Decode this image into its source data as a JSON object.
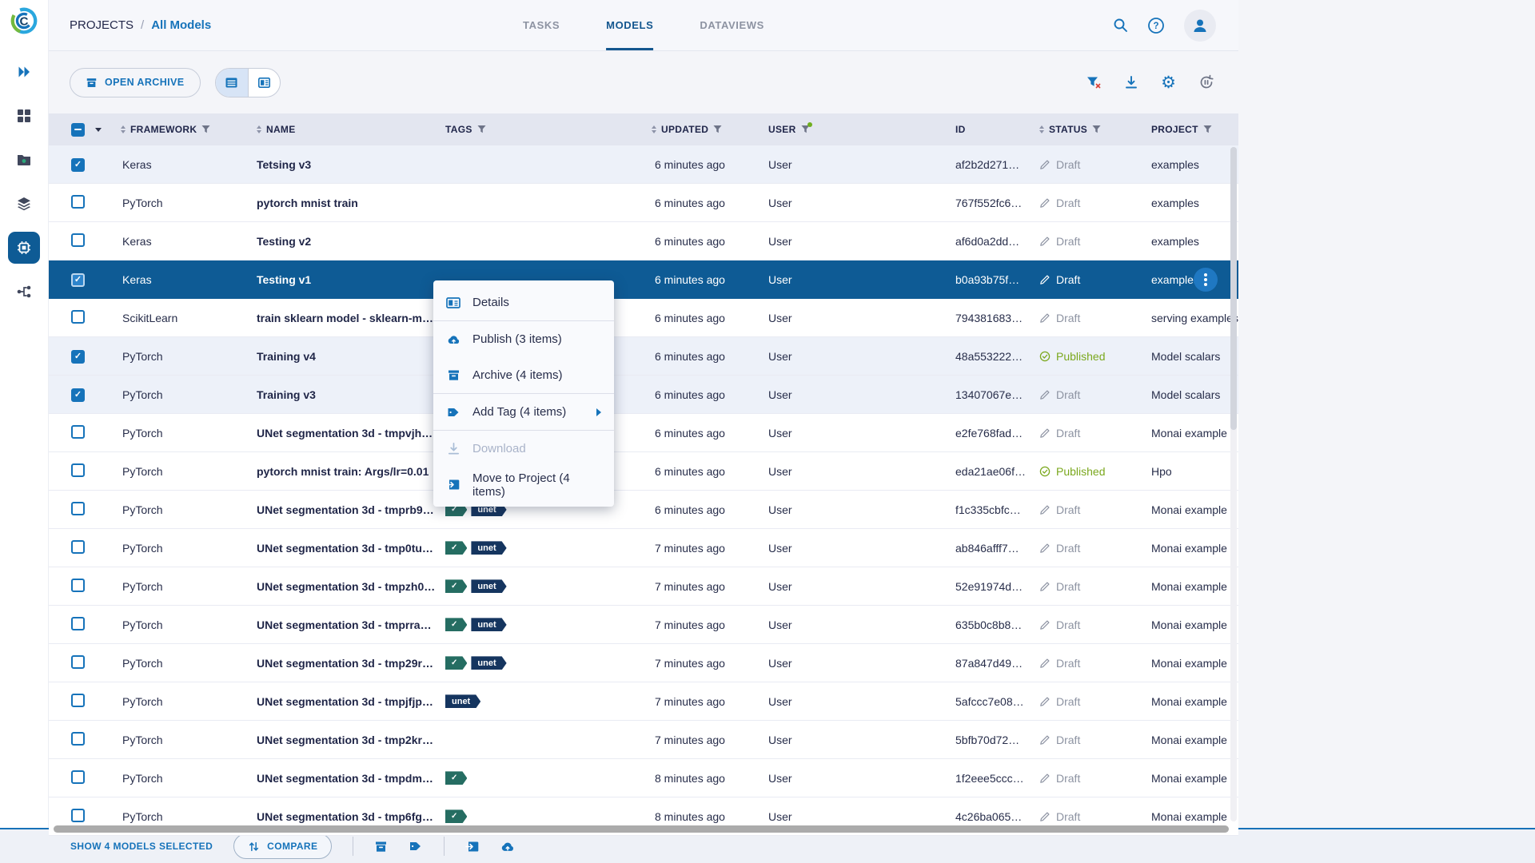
{
  "brand": {
    "logo_letter": "C"
  },
  "breadcrumb": {
    "root": "PROJECTS",
    "separator": "/",
    "current": "All Models"
  },
  "tabs": [
    {
      "label": "TASKS"
    },
    {
      "label": "MODELS"
    },
    {
      "label": "DATAVIEWS"
    }
  ],
  "toolbar": {
    "open_archive": "OPEN ARCHIVE"
  },
  "table": {
    "headers": {
      "framework": "FRAMEWORK",
      "name": "NAME",
      "tags": "TAGS",
      "updated": "UPDATED",
      "user": "USER",
      "id": "ID",
      "status": "STATUS",
      "project": "PROJECT"
    },
    "rows": [
      {
        "framework": "Keras",
        "name": "Tetsing v3",
        "tags": [],
        "updated": "6 minutes ago",
        "user": "User",
        "id": "af2b2d271…",
        "status": "Draft",
        "status_type": "draft",
        "project": "examples",
        "checked": true,
        "selected": false
      },
      {
        "framework": "PyTorch",
        "name": "pytorch mnist train",
        "tags": [],
        "updated": "6 minutes ago",
        "user": "User",
        "id": "767f552fc6…",
        "status": "Draft",
        "status_type": "draft",
        "project": "examples",
        "checked": false,
        "selected": false
      },
      {
        "framework": "Keras",
        "name": "Testing v2",
        "tags": [],
        "updated": "6 minutes ago",
        "user": "User",
        "id": "af6d0a2dd…",
        "status": "Draft",
        "status_type": "draft",
        "project": "examples",
        "checked": false,
        "selected": false
      },
      {
        "framework": "Keras",
        "name": "Testing v1",
        "tags": [],
        "updated": "6 minutes ago",
        "user": "User",
        "id": "b0a93b75f…",
        "status": "Draft",
        "status_type": "draft",
        "project": "examples",
        "checked": true,
        "selected": true
      },
      {
        "framework": "ScikitLearn",
        "name": "train sklearn model - sklearn-mo…",
        "tags": [],
        "updated": "6 minutes ago",
        "user": "User",
        "id": "794381683…",
        "status": "Draft",
        "status_type": "draft",
        "project": "serving examples",
        "checked": false,
        "selected": false
      },
      {
        "framework": "PyTorch",
        "name": "Training v4",
        "tags": [],
        "updated": "6 minutes ago",
        "user": "User",
        "id": "48a553222…",
        "status": "Published",
        "status_type": "published",
        "project": "Model scalars",
        "checked": true,
        "selected": false
      },
      {
        "framework": "PyTorch",
        "name": "Training v3",
        "tags": [],
        "updated": "6 minutes ago",
        "user": "User",
        "id": "13407067e…",
        "status": "Draft",
        "status_type": "draft",
        "project": "Model scalars",
        "checked": true,
        "selected": false
      },
      {
        "framework": "PyTorch",
        "name": "UNet segmentation 3d - tmpvjhyl…",
        "tags": [],
        "updated": "6 minutes ago",
        "user": "User",
        "id": "e2fe768fad…",
        "status": "Draft",
        "status_type": "draft",
        "project": "Monai example",
        "checked": false,
        "selected": false
      },
      {
        "framework": "PyTorch",
        "name": "pytorch mnist train: Args/lr=0.01",
        "tags": [],
        "updated": "6 minutes ago",
        "user": "User",
        "id": "eda21ae06f…",
        "status": "Published",
        "status_type": "published",
        "project": "Hpo",
        "checked": false,
        "selected": false
      },
      {
        "framework": "PyTorch",
        "name": "UNet segmentation 3d - tmprb9d…",
        "tags": [
          "check",
          "unet"
        ],
        "updated": "6 minutes ago",
        "user": "User",
        "id": "f1c335cbfc…",
        "status": "Draft",
        "status_type": "draft",
        "project": "Monai example",
        "checked": false,
        "selected": false
      },
      {
        "framework": "PyTorch",
        "name": "UNet segmentation 3d - tmp0tu…",
        "tags": [
          "check",
          "unet"
        ],
        "updated": "7 minutes ago",
        "user": "User",
        "id": "ab846afff7…",
        "status": "Draft",
        "status_type": "draft",
        "project": "Monai example",
        "checked": false,
        "selected": false
      },
      {
        "framework": "PyTorch",
        "name": "UNet segmentation 3d - tmpzh0…",
        "tags": [
          "check",
          "unet"
        ],
        "updated": "7 minutes ago",
        "user": "User",
        "id": "52e91974d…",
        "status": "Draft",
        "status_type": "draft",
        "project": "Monai example",
        "checked": false,
        "selected": false
      },
      {
        "framework": "PyTorch",
        "name": "UNet segmentation 3d - tmprrae…",
        "tags": [
          "check",
          "unet"
        ],
        "updated": "7 minutes ago",
        "user": "User",
        "id": "635b0c8b8…",
        "status": "Draft",
        "status_type": "draft",
        "project": "Monai example",
        "checked": false,
        "selected": false
      },
      {
        "framework": "PyTorch",
        "name": "UNet segmentation 3d - tmp29rf…",
        "tags": [
          "check",
          "unet"
        ],
        "updated": "7 minutes ago",
        "user": "User",
        "id": "87a847d49…",
        "status": "Draft",
        "status_type": "draft",
        "project": "Monai example",
        "checked": false,
        "selected": false
      },
      {
        "framework": "PyTorch",
        "name": "UNet segmentation 3d - tmpjfjpv…",
        "tags": [
          "unet"
        ],
        "updated": "7 minutes ago",
        "user": "User",
        "id": "5afccc7e08…",
        "status": "Draft",
        "status_type": "draft",
        "project": "Monai example",
        "checked": false,
        "selected": false
      },
      {
        "framework": "PyTorch",
        "name": "UNet segmentation 3d - tmp2kr0…",
        "tags": [],
        "updated": "7 minutes ago",
        "user": "User",
        "id": "5bfb70d72…",
        "status": "Draft",
        "status_type": "draft",
        "project": "Monai example",
        "checked": false,
        "selected": false
      },
      {
        "framework": "PyTorch",
        "name": "UNet segmentation 3d - tmpdm4…",
        "tags": [
          "check"
        ],
        "updated": "8 minutes ago",
        "user": "User",
        "id": "1f2eee5ccc…",
        "status": "Draft",
        "status_type": "draft",
        "project": "Monai example",
        "checked": false,
        "selected": false
      },
      {
        "framework": "PyTorch",
        "name": "UNet segmentation 3d - tmp6fg0…",
        "tags": [
          "check"
        ],
        "updated": "8 minutes ago",
        "user": "User",
        "id": "4c26ba065…",
        "status": "Draft",
        "status_type": "draft",
        "project": "Monai example",
        "checked": false,
        "selected": false
      }
    ]
  },
  "context_menu": {
    "items": [
      {
        "label": "Details"
      },
      {
        "label": "Publish (3 items)"
      },
      {
        "label": "Archive (4 items)"
      },
      {
        "label": "Add Tag (4 items)"
      },
      {
        "label": "Download"
      },
      {
        "label": "Move to Project (4 items)"
      }
    ]
  },
  "footer": {
    "selection": "SHOW 4 MODELS SELECTED",
    "compare": "COMPARE"
  },
  "colors": {
    "accent": "#1673ba",
    "selected_row": "#0e5b95",
    "published": "#7ba81e",
    "draft_gray": "#8d93a2",
    "tag_check": "#256d62",
    "tag_label": "#15355f",
    "header_band": "#e3e6f0"
  }
}
